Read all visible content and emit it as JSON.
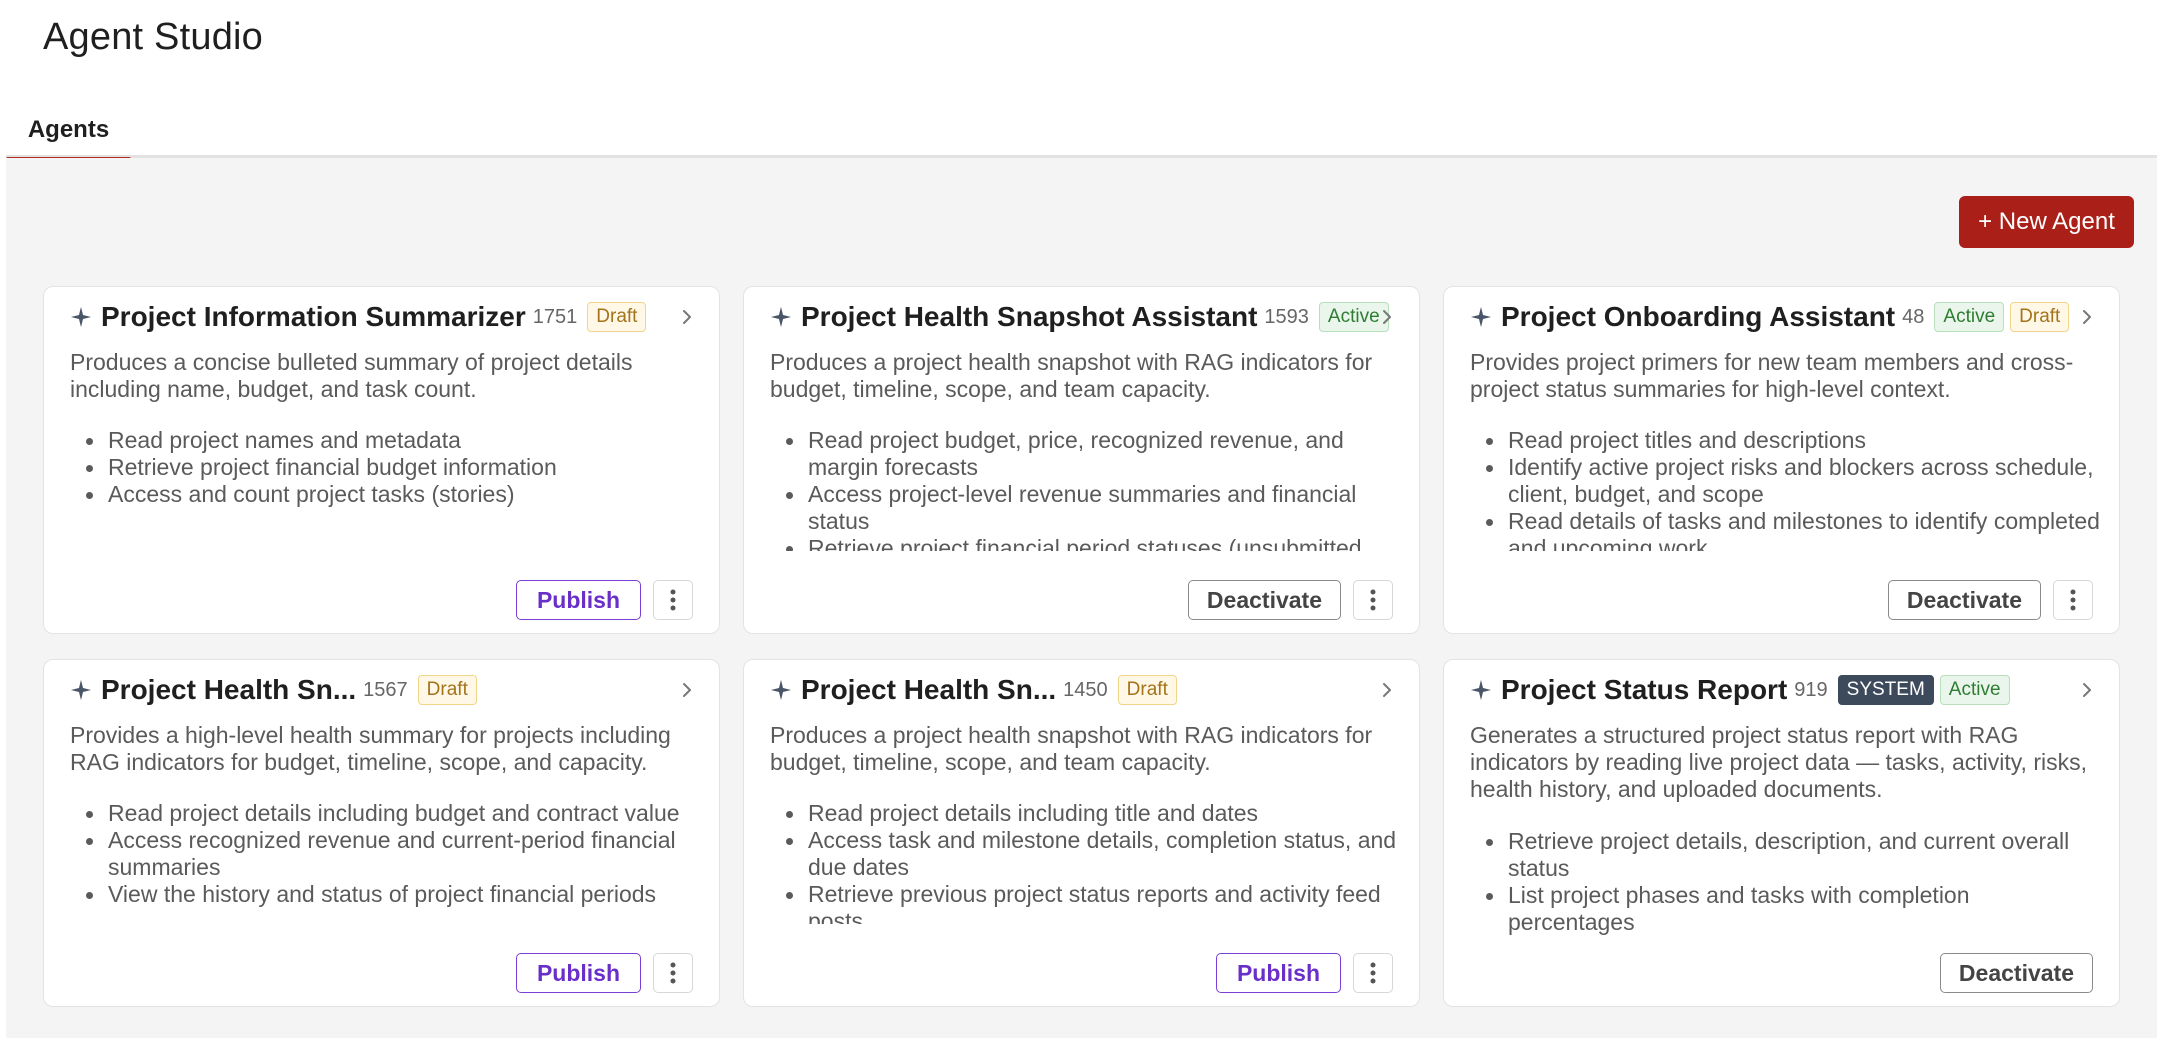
{
  "app": {
    "title": "Agent Studio"
  },
  "tabs": [
    {
      "label": "Agents"
    }
  ],
  "toolbar": {
    "new_agent_label": "+ New Agent"
  },
  "colors": {
    "accent": "#aa1f18",
    "publish": "#6a2fc9",
    "active": "#2e7d32",
    "draft": "#a4731a",
    "system": "#3d4a5c"
  },
  "cards": [
    {
      "title": "Project Information Summarizer",
      "count": "1751",
      "badges": [
        {
          "label": "Draft",
          "kind": "draft"
        }
      ],
      "description": "Produces a concise bulleted summary of project details including name, budget, and task count.",
      "capabilities": [
        "Read project names and metadata",
        "Retrieve project financial budget information",
        "Access and count project tasks (stories)"
      ],
      "primary_action": {
        "label": "Publish",
        "kind": "publish"
      },
      "has_menu": true
    },
    {
      "title": "Project Health Snapshot Assistant",
      "count": "1593",
      "badges": [
        {
          "label": "Active",
          "kind": "active"
        }
      ],
      "description": "Produces a project health snapshot with RAG indicators for budget, timeline, scope, and team capacity.",
      "capabilities": [
        "Read project budget, price, recognized revenue, and margin forecasts",
        "Access project-level revenue summaries and financial status",
        "Retrieve project financial period statuses (unsubmitted,"
      ],
      "primary_action": {
        "label": "Deactivate",
        "kind": "deactivate"
      },
      "has_menu": true
    },
    {
      "title": "Project Onboarding Assistant",
      "count": "48",
      "badges": [
        {
          "label": "Active",
          "kind": "active"
        },
        {
          "label": "Draft",
          "kind": "draft"
        }
      ],
      "description": "Provides project primers for new team members and cross-project status summaries for high-level context.",
      "capabilities": [
        "Read project titles and descriptions",
        "Identify active project risks and blockers across schedule, client, budget, and scope",
        "Read details of tasks and milestones to identify completed and upcoming work"
      ],
      "primary_action": {
        "label": "Deactivate",
        "kind": "deactivate"
      },
      "has_menu": true
    },
    {
      "title": "Project Health Sn...",
      "count": "1567",
      "badges": [
        {
          "label": "Draft",
          "kind": "draft"
        }
      ],
      "description": "Provides a high-level health summary for projects including RAG indicators for budget, timeline, scope, and capacity.",
      "capabilities": [
        "Read project details including budget and contract value",
        "Access recognized revenue and current-period financial summaries",
        "View the history and status of project financial periods"
      ],
      "primary_action": {
        "label": "Publish",
        "kind": "publish"
      },
      "has_menu": true
    },
    {
      "title": "Project Health Sn...",
      "count": "1450",
      "badges": [
        {
          "label": "Draft",
          "kind": "draft"
        }
      ],
      "description": "Produces a project health snapshot with RAG indicators for budget, timeline, scope, and team capacity.",
      "capabilities": [
        "Read project details including title and dates",
        "Access task and milestone details, completion status, and due dates",
        "Retrieve previous project status reports and activity feed posts"
      ],
      "primary_action": {
        "label": "Publish",
        "kind": "publish"
      },
      "has_menu": true
    },
    {
      "title": "Project Status Report",
      "count": "919",
      "badges": [
        {
          "label": "SYSTEM",
          "kind": "system"
        },
        {
          "label": "Active",
          "kind": "active"
        }
      ],
      "description": "Generates a structured project status report with RAG indicators by reading live project data — tasks, activity, risks, health history, and uploaded documents.",
      "capabilities": [
        "Retrieve project details, description, and current overall status",
        "List project phases and tasks with completion percentages"
      ],
      "primary_action": {
        "label": "Deactivate",
        "kind": "deactivate"
      },
      "has_menu": false
    }
  ]
}
